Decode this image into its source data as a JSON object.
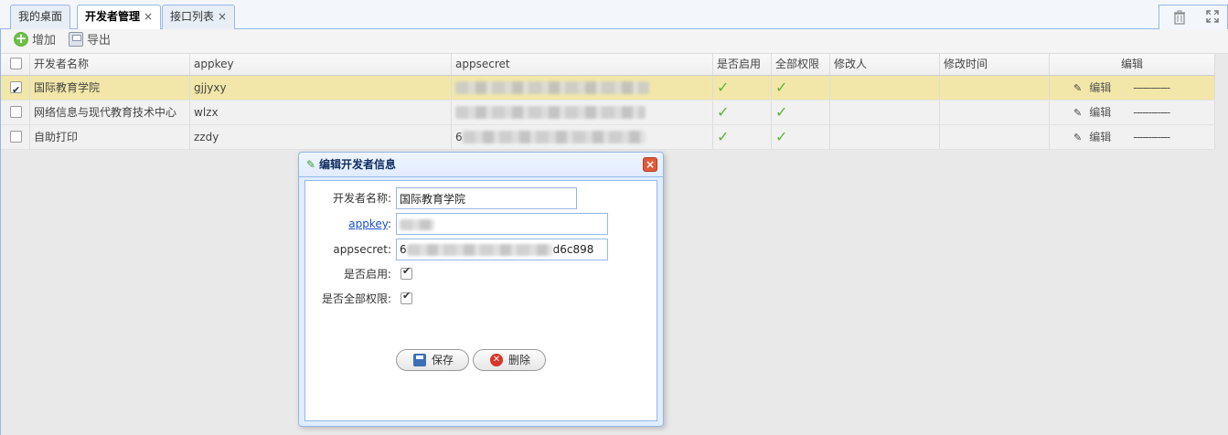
{
  "tabs": [
    {
      "label": "我的桌面",
      "closable": false,
      "active": false
    },
    {
      "label": "开发者管理",
      "closable": true,
      "active": true
    },
    {
      "label": "接口列表",
      "closable": true,
      "active": false
    }
  ],
  "tab_close_symbol": "×",
  "tab_tools": {
    "delete_icon": "trash-icon",
    "fullscreen_icon": "expand-icon"
  },
  "toolbar": {
    "add_label": "增加",
    "export_label": "导出"
  },
  "grid": {
    "columns": [
      "开发者名称",
      "appkey",
      "appsecret",
      "是否启用",
      "全部权限",
      "修改人",
      "修改时间",
      "编辑"
    ],
    "rows": [
      {
        "checked": true,
        "name": "国际教育学院",
        "appkey": "gjjyxy",
        "appsecret_prefix": "",
        "enabled": true,
        "all_perms": true,
        "modifier": "",
        "modified_time": "",
        "edit_label": "编辑",
        "dashes": "------------"
      },
      {
        "checked": false,
        "name": "网络信息与现代教育技术中心",
        "appkey": "wlzx",
        "appsecret_prefix": "",
        "enabled": true,
        "all_perms": true,
        "modifier": "",
        "modified_time": "",
        "edit_label": "编辑",
        "dashes": "------------"
      },
      {
        "checked": false,
        "name": "自助打印",
        "appkey": "zzdy",
        "appsecret_prefix": "6",
        "enabled": true,
        "all_perms": true,
        "modifier": "",
        "modified_time": "",
        "edit_label": "编辑",
        "dashes": "------------"
      }
    ],
    "check_mark": "✔"
  },
  "dialog": {
    "title": "编辑开发者信息",
    "close_symbol": "×",
    "fields": {
      "name_label": "开发者名称:",
      "name_value": "国际教育学院",
      "appkey_label": "appkey",
      "appkey_colon": ":",
      "appsecret_label": "appsecret:",
      "appsecret_prefix": "6",
      "appsecret_suffix": "d6c898",
      "enabled_label": "是否启用:",
      "enabled": true,
      "allperm_label": "是否全部权限:",
      "all_perms": true
    },
    "save_label": "保存",
    "delete_label": "删除"
  },
  "colors": {
    "accent_border": "#95b8e7",
    "selected_row": "#f2e7a9",
    "tick_green": "#5fb23c",
    "close_red": "#e05a3a"
  }
}
